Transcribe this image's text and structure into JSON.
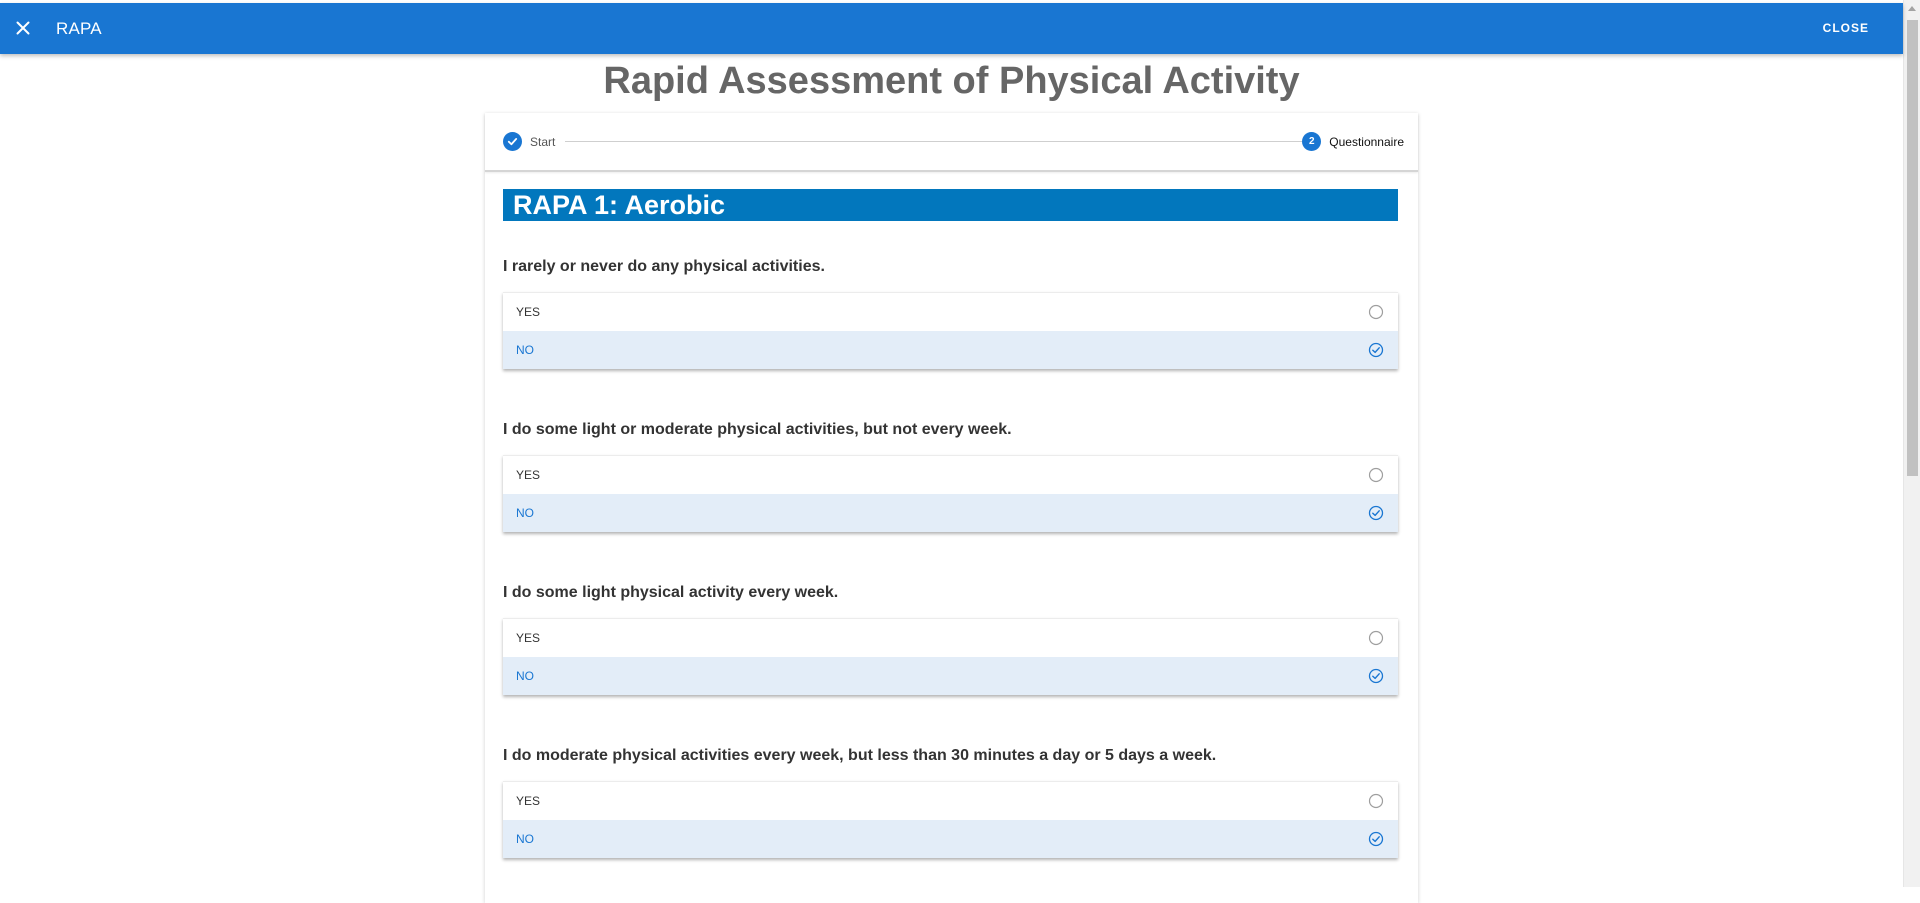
{
  "appbar": {
    "title": "RAPA",
    "close_label": "CLOSE",
    "color": "#1976d2"
  },
  "page": {
    "title": "Rapid Assessment of Physical Activity"
  },
  "stepper": {
    "steps": [
      {
        "label": "Start",
        "state": "completed",
        "icon": "check-icon"
      },
      {
        "label": "Questionnaire",
        "state": "active",
        "number": "2"
      }
    ]
  },
  "section": {
    "title": "RAPA 1: Aerobic",
    "color": "#0277bd"
  },
  "questions": [
    {
      "text": "I rarely or never do any physical activities.",
      "options": [
        {
          "label": "YES",
          "selected": false
        },
        {
          "label": "NO",
          "selected": true
        }
      ]
    },
    {
      "text": "I do some light or moderate physical activities, but not every week.",
      "options": [
        {
          "label": "YES",
          "selected": false
        },
        {
          "label": "NO",
          "selected": true
        }
      ]
    },
    {
      "text": "I do some light physical activity every week.",
      "options": [
        {
          "label": "YES",
          "selected": false
        },
        {
          "label": "NO",
          "selected": true
        }
      ]
    },
    {
      "text": "I do moderate physical activities every week, but less than 30 minutes a day or 5 days a week.",
      "options": [
        {
          "label": "YES",
          "selected": false
        },
        {
          "label": "NO",
          "selected": true
        }
      ]
    }
  ]
}
